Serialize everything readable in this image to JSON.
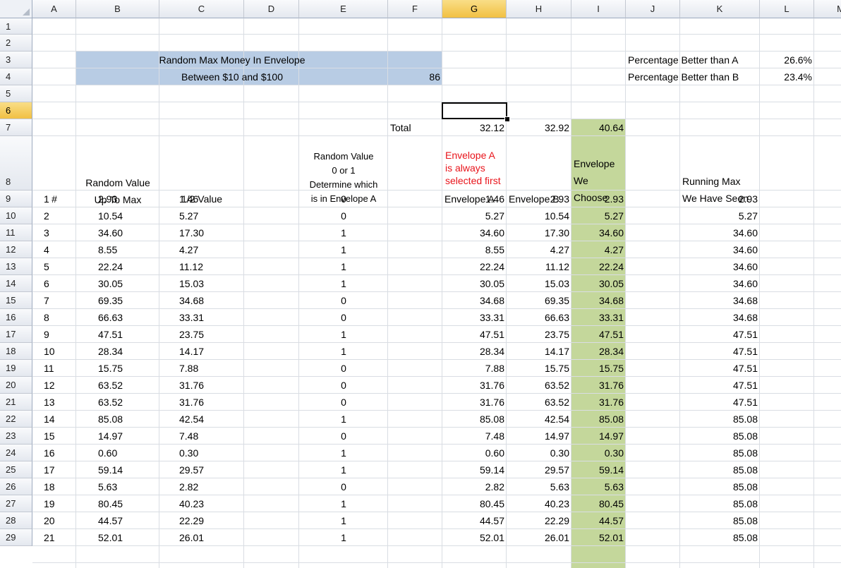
{
  "columns": [
    "A",
    "B",
    "C",
    "D",
    "E",
    "F",
    "G",
    "H",
    "I",
    "J",
    "K",
    "L",
    "M"
  ],
  "row_numbers": [
    "1",
    "2",
    "3",
    "4",
    "5",
    "6",
    "7",
    "8",
    "9",
    "10",
    "11",
    "12",
    "13",
    "14",
    "15",
    "16",
    "17",
    "18",
    "19",
    "20",
    "21",
    "22",
    "23",
    "24",
    "25",
    "26",
    "27",
    "28",
    "29"
  ],
  "selected_column": "G",
  "selected_row": "6",
  "colors": {
    "title_fill": "#b8cce4",
    "choose_fill": "#c4d79b",
    "note_red": "#e8141b",
    "header_selected": "#f4c94e"
  },
  "title": {
    "line1": "Random Max Money In Envelope",
    "line2": "Between $10 and $100",
    "max_value": "86"
  },
  "stats": [
    {
      "label": "Percentage Better than A",
      "value": "26.6%"
    },
    {
      "label": "Percentage Better than B",
      "value": "23.4%"
    }
  ],
  "totals": {
    "label": "Total",
    "envelope_a": "32.12",
    "envelope_b": "32.92",
    "chosen": "40.64"
  },
  "headers": {
    "num": "#",
    "random_value": [
      "Random Value",
      "Up To Max"
    ],
    "half_value": "1/2 Value",
    "binary": [
      "Random Value",
      "0 or 1",
      "Determine which",
      "is in Envelope A"
    ],
    "note": [
      "Envelope A",
      "is always",
      "selected first"
    ],
    "envelope_a": "Envelope A",
    "envelope_b": "Envelope B",
    "chosen": [
      "Envelope",
      "We",
      "Choose"
    ],
    "running_max": [
      "Running Max",
      "We Have Seen"
    ]
  },
  "rows": [
    {
      "n": "1",
      "rv": "2.93",
      "half": "1.46",
      "bit": "0",
      "a": "1.46",
      "b": "2.93",
      "choose": "2.93",
      "max": "2.93"
    },
    {
      "n": "2",
      "rv": "10.54",
      "half": "5.27",
      "bit": "0",
      "a": "5.27",
      "b": "10.54",
      "choose": "5.27",
      "max": "5.27"
    },
    {
      "n": "3",
      "rv": "34.60",
      "half": "17.30",
      "bit": "1",
      "a": "34.60",
      "b": "17.30",
      "choose": "34.60",
      "max": "34.60"
    },
    {
      "n": "4",
      "rv": "8.55",
      "half": "4.27",
      "bit": "1",
      "a": "8.55",
      "b": "4.27",
      "choose": "4.27",
      "max": "34.60"
    },
    {
      "n": "5",
      "rv": "22.24",
      "half": "11.12",
      "bit": "1",
      "a": "22.24",
      "b": "11.12",
      "choose": "22.24",
      "max": "34.60"
    },
    {
      "n": "6",
      "rv": "30.05",
      "half": "15.03",
      "bit": "1",
      "a": "30.05",
      "b": "15.03",
      "choose": "30.05",
      "max": "34.60"
    },
    {
      "n": "7",
      "rv": "69.35",
      "half": "34.68",
      "bit": "0",
      "a": "34.68",
      "b": "69.35",
      "choose": "34.68",
      "max": "34.68"
    },
    {
      "n": "8",
      "rv": "66.63",
      "half": "33.31",
      "bit": "0",
      "a": "33.31",
      "b": "66.63",
      "choose": "33.31",
      "max": "34.68"
    },
    {
      "n": "9",
      "rv": "47.51",
      "half": "23.75",
      "bit": "1",
      "a": "47.51",
      "b": "23.75",
      "choose": "47.51",
      "max": "47.51"
    },
    {
      "n": "10",
      "rv": "28.34",
      "half": "14.17",
      "bit": "1",
      "a": "28.34",
      "b": "14.17",
      "choose": "28.34",
      "max": "47.51"
    },
    {
      "n": "11",
      "rv": "15.75",
      "half": "7.88",
      "bit": "0",
      "a": "7.88",
      "b": "15.75",
      "choose": "15.75",
      "max": "47.51"
    },
    {
      "n": "12",
      "rv": "63.52",
      "half": "31.76",
      "bit": "0",
      "a": "31.76",
      "b": "63.52",
      "choose": "31.76",
      "max": "47.51"
    },
    {
      "n": "13",
      "rv": "63.52",
      "half": "31.76",
      "bit": "0",
      "a": "31.76",
      "b": "63.52",
      "choose": "31.76",
      "max": "47.51"
    },
    {
      "n": "14",
      "rv": "85.08",
      "half": "42.54",
      "bit": "1",
      "a": "85.08",
      "b": "42.54",
      "choose": "85.08",
      "max": "85.08"
    },
    {
      "n": "15",
      "rv": "14.97",
      "half": "7.48",
      "bit": "0",
      "a": "7.48",
      "b": "14.97",
      "choose": "14.97",
      "max": "85.08"
    },
    {
      "n": "16",
      "rv": "0.60",
      "half": "0.30",
      "bit": "1",
      "a": "0.60",
      "b": "0.30",
      "choose": "0.30",
      "max": "85.08"
    },
    {
      "n": "17",
      "rv": "59.14",
      "half": "29.57",
      "bit": "1",
      "a": "59.14",
      "b": "29.57",
      "choose": "59.14",
      "max": "85.08"
    },
    {
      "n": "18",
      "rv": "5.63",
      "half": "2.82",
      "bit": "0",
      "a": "2.82",
      "b": "5.63",
      "choose": "5.63",
      "max": "85.08"
    },
    {
      "n": "19",
      "rv": "80.45",
      "half": "40.23",
      "bit": "1",
      "a": "80.45",
      "b": "40.23",
      "choose": "80.45",
      "max": "85.08"
    },
    {
      "n": "20",
      "rv": "44.57",
      "half": "22.29",
      "bit": "1",
      "a": "44.57",
      "b": "22.29",
      "choose": "44.57",
      "max": "85.08"
    },
    {
      "n": "21",
      "rv": "52.01",
      "half": "26.01",
      "bit": "1",
      "a": "52.01",
      "b": "26.01",
      "choose": "52.01",
      "max": "85.08"
    }
  ]
}
